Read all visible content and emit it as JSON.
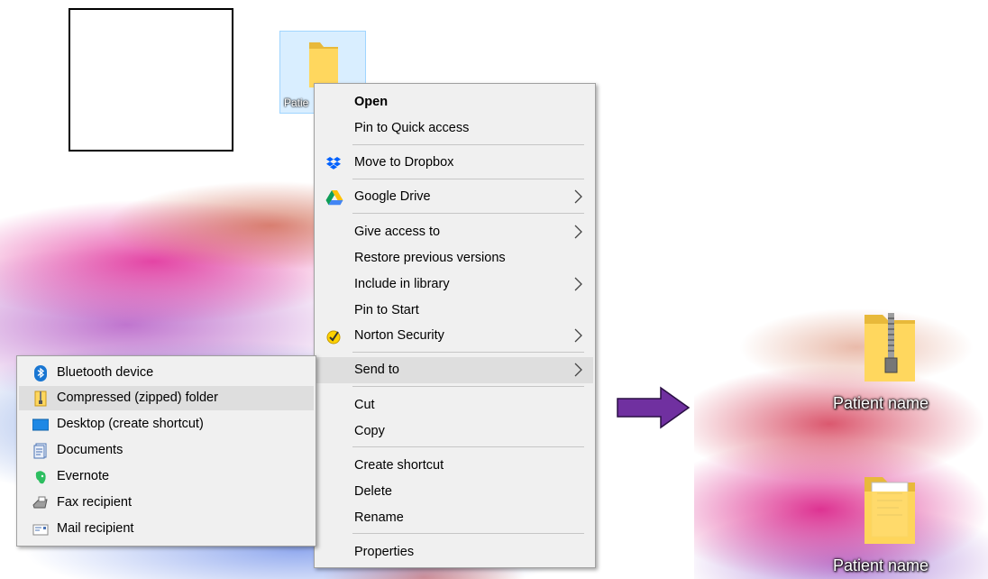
{
  "desktop_left": {
    "selected_icon": {
      "label": "Patie",
      "icon": "folder-icon"
    }
  },
  "context_menu": {
    "items": [
      {
        "label": "Open",
        "bold": true
      },
      {
        "label": "Pin to Quick access"
      },
      {
        "label": "Move to Dropbox",
        "icon": "dropbox-icon"
      },
      {
        "label": "Google Drive",
        "icon": "google-drive-icon",
        "submenu": true
      },
      {
        "label": "Give access to",
        "submenu": true
      },
      {
        "label": "Restore previous versions"
      },
      {
        "label": "Include in library",
        "submenu": true
      },
      {
        "label": "Pin to Start"
      },
      {
        "label": "Norton Security",
        "icon": "norton-icon",
        "submenu": true
      },
      {
        "label": "Send to",
        "submenu": true,
        "highlighted": true
      },
      {
        "label": "Cut"
      },
      {
        "label": "Copy"
      },
      {
        "label": "Create shortcut"
      },
      {
        "label": "Delete"
      },
      {
        "label": "Rename"
      },
      {
        "label": "Properties"
      }
    ]
  },
  "send_to_menu": {
    "items": [
      {
        "label": "Bluetooth device",
        "icon": "bluetooth-icon"
      },
      {
        "label": "Compressed (zipped) folder",
        "icon": "zip-folder-icon",
        "highlighted": true
      },
      {
        "label": "Desktop (create shortcut)",
        "icon": "desktop-icon"
      },
      {
        "label": "Documents",
        "icon": "documents-icon"
      },
      {
        "label": "Evernote",
        "icon": "evernote-icon"
      },
      {
        "label": "Fax recipient",
        "icon": "fax-icon"
      },
      {
        "label": "Mail recipient",
        "icon": "mail-icon"
      }
    ]
  },
  "desktop_right": {
    "icons": [
      {
        "label": "Patient name",
        "icon": "zip-folder-icon"
      },
      {
        "label": "Patient name",
        "icon": "folder-icon"
      }
    ]
  },
  "colors": {
    "arrow": "#7030a0",
    "menu_bg": "#f0f0f0",
    "highlight": "#dedede"
  }
}
